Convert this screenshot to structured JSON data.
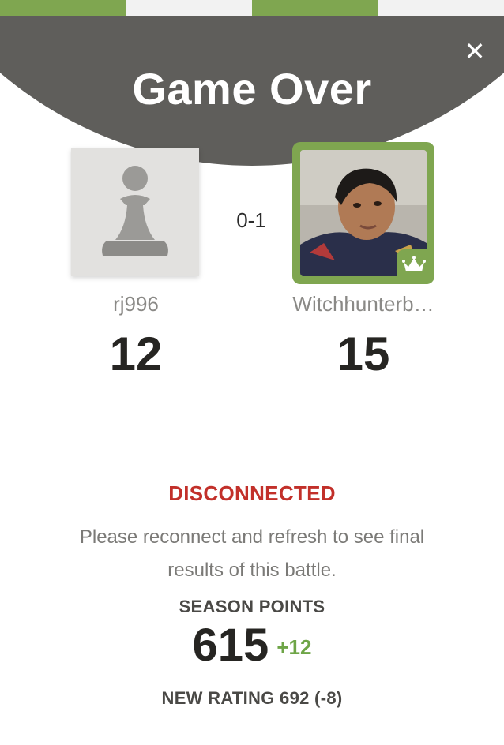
{
  "modal": {
    "title": "Game Over",
    "close_label": "✕",
    "result": "0-1"
  },
  "players": [
    {
      "username": "rj996",
      "score": "12",
      "avatar": "pawn-icon"
    },
    {
      "username": "Witchhunterb…",
      "score": "15",
      "avatar": "user-photo",
      "badge": "crown-icon"
    }
  ],
  "status": {
    "label": "DISCONNECTED",
    "message": "Please reconnect and refresh to see final results of this battle."
  },
  "season": {
    "label": "SEASON POINTS",
    "value": "615",
    "delta": "+12"
  },
  "rating": {
    "text": "NEW RATING 692 (-8)"
  },
  "colors": {
    "header": "#5f5e5b",
    "accent_green": "#7fa650",
    "error_red": "#c2302a"
  }
}
